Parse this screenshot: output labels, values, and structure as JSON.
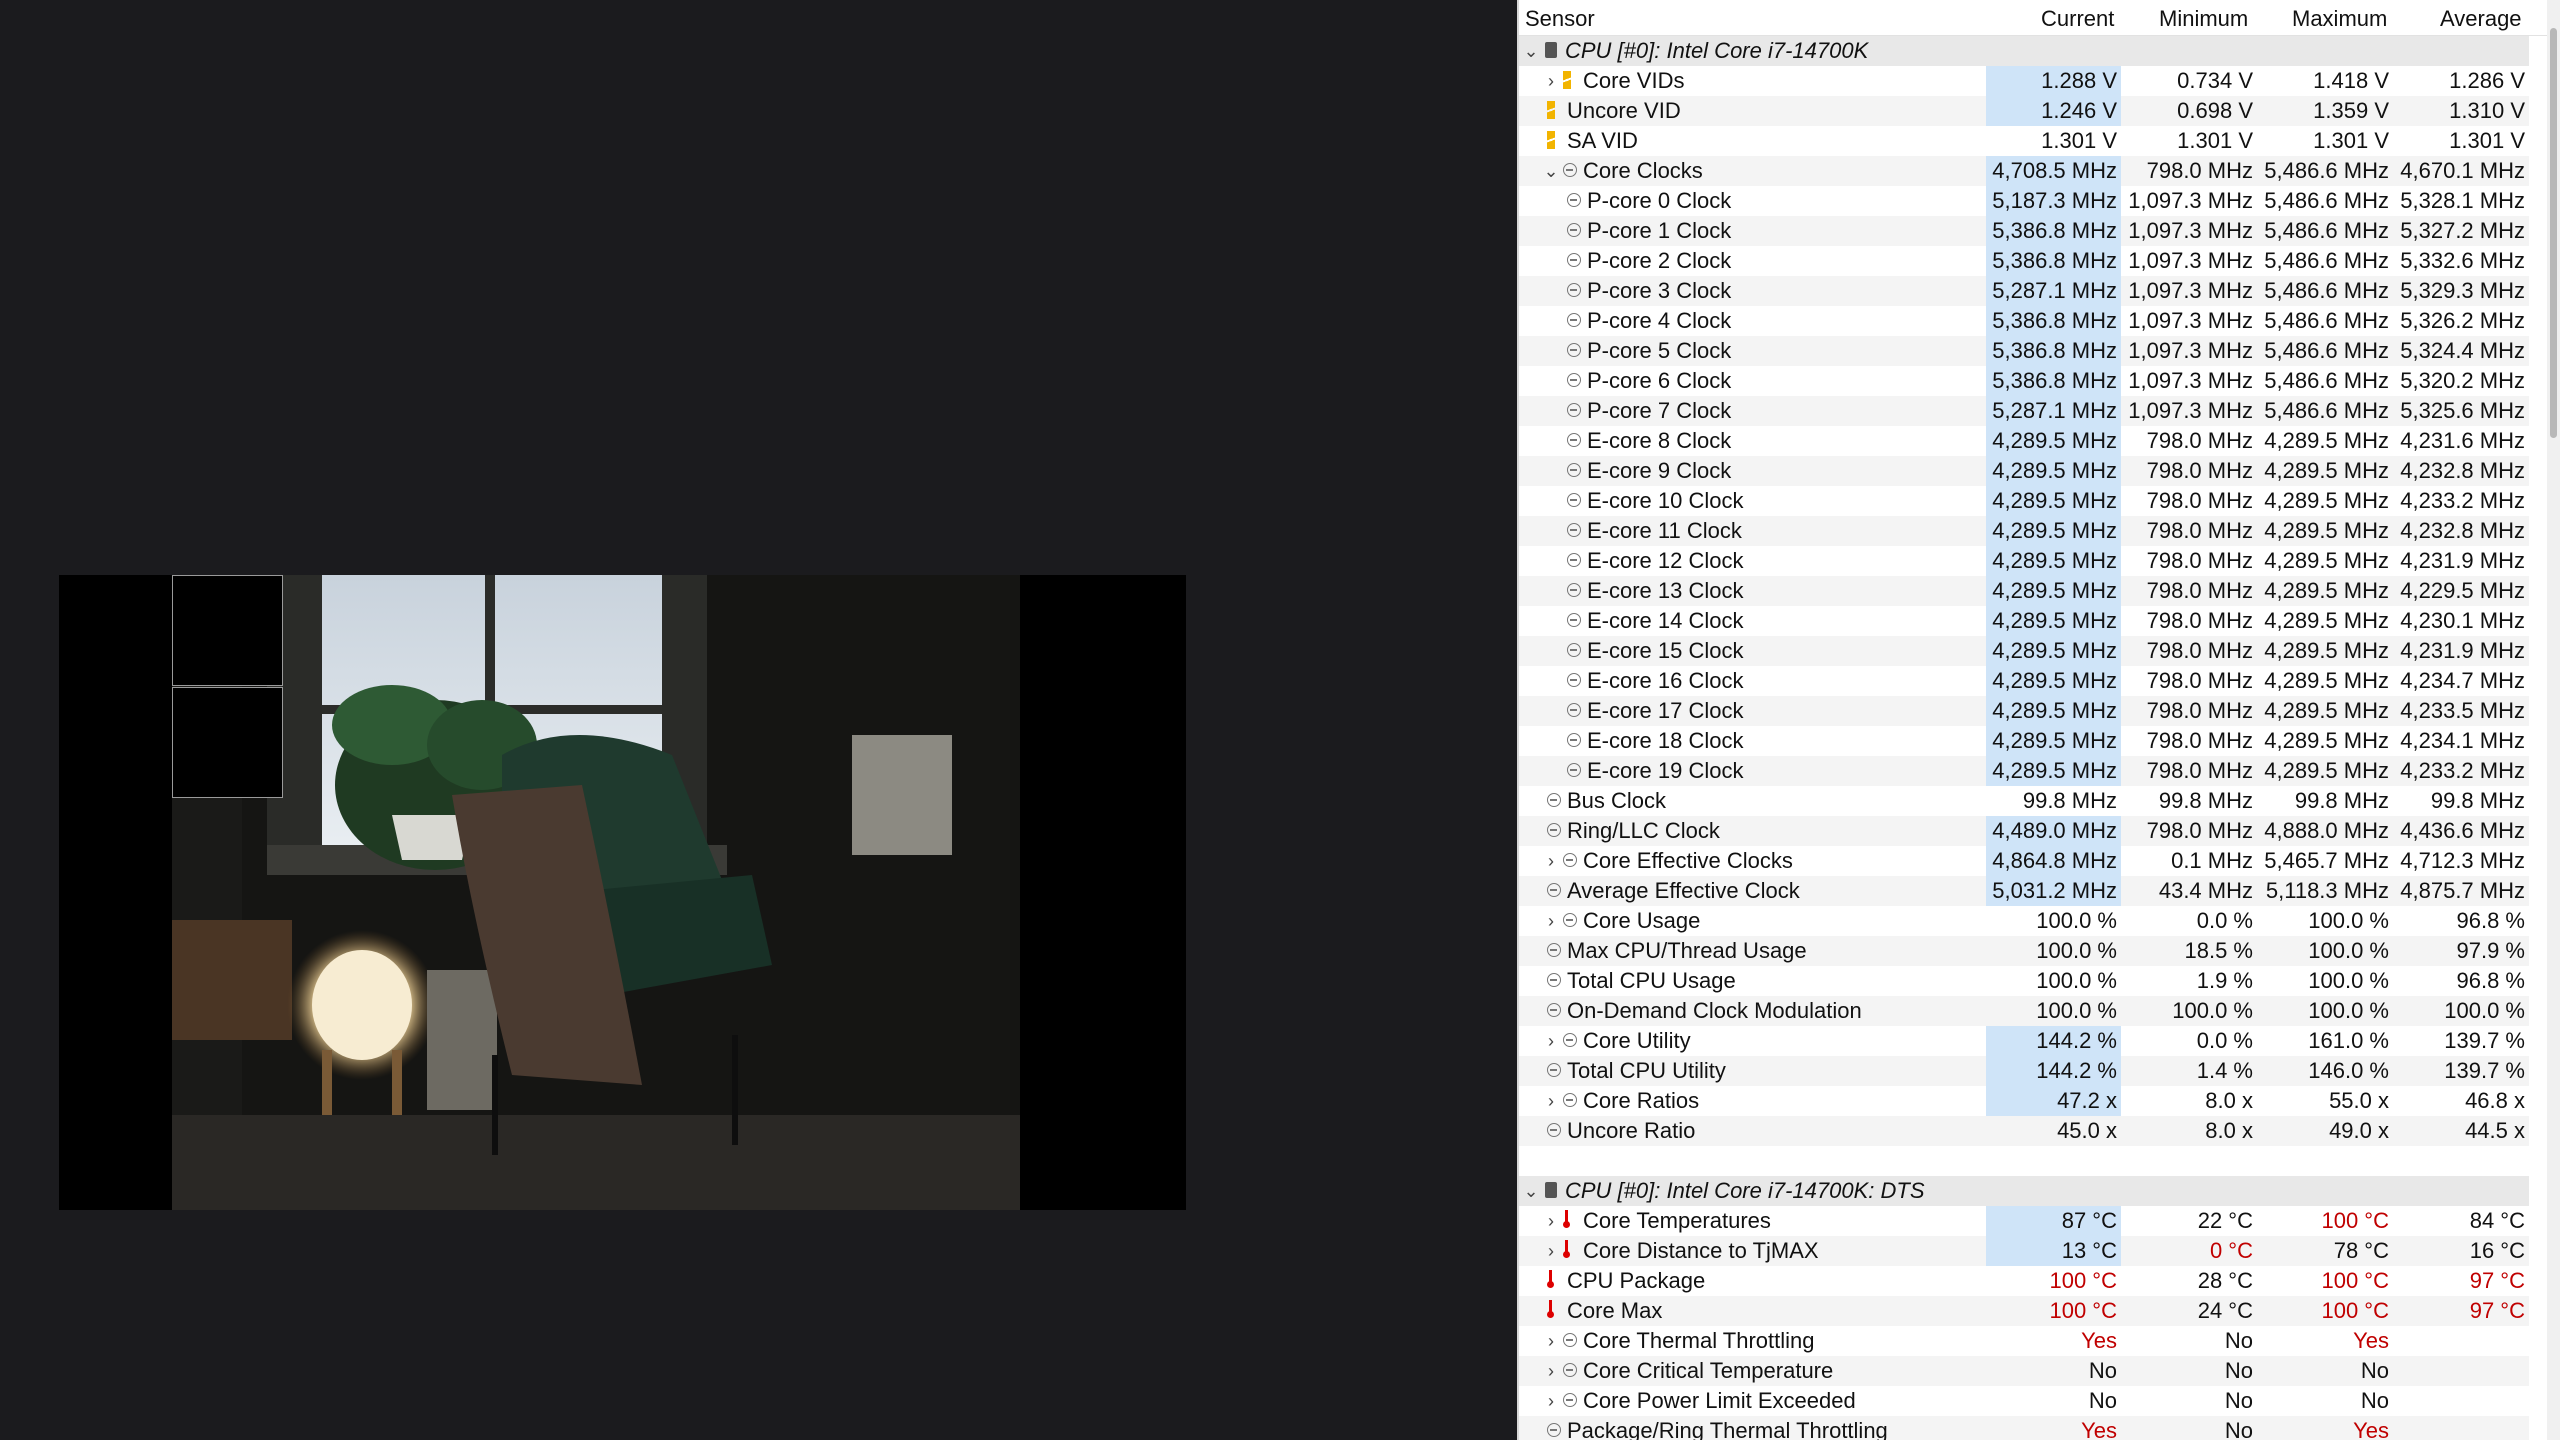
{
  "header": {
    "sensor": "Sensor",
    "current": "Current",
    "minimum": "Minimum",
    "maximum": "Maximum",
    "average": "Average"
  },
  "colors": {
    "highlight": "#cfe4f8",
    "alarm": "#c00000",
    "group_bg": "#e8e8e8"
  },
  "rows": [
    {
      "label": "CPU [#0]: Intel Core i7-14700K",
      "type": "group",
      "icon": "chip-icon",
      "expand": "⌄"
    },
    {
      "label": "Core VIDs",
      "icon": "voltage-icon",
      "expand": "›",
      "indent": 1,
      "cur": "1.288 V",
      "min": "0.734 V",
      "max": "1.418 V",
      "avg": "1.286 V",
      "hl": true
    },
    {
      "label": "Uncore VID",
      "icon": "voltage-icon",
      "indent": 1,
      "cur": "1.246 V",
      "min": "0.698 V",
      "max": "1.359 V",
      "avg": "1.310 V",
      "hl": true
    },
    {
      "label": "SA VID",
      "icon": "voltage-icon",
      "indent": 1,
      "cur": "1.301 V",
      "min": "1.301 V",
      "max": "1.301 V",
      "avg": "1.301 V"
    },
    {
      "label": "Core Clocks",
      "icon": "clock-icon",
      "expand": "⌄",
      "indent": 1,
      "cur": "4,708.5 MHz",
      "min": "798.0 MHz",
      "max": "5,486.6 MHz",
      "avg": "4,670.1 MHz",
      "hl": true
    },
    {
      "label": "P-core 0 Clock",
      "icon": "clock-icon",
      "indent": 2,
      "cur": "5,187.3 MHz",
      "min": "1,097.3 MHz",
      "max": "5,486.6 MHz",
      "avg": "5,328.1 MHz",
      "hl": true
    },
    {
      "label": "P-core 1 Clock",
      "icon": "clock-icon",
      "indent": 2,
      "cur": "5,386.8 MHz",
      "min": "1,097.3 MHz",
      "max": "5,486.6 MHz",
      "avg": "5,327.2 MHz",
      "hl": true
    },
    {
      "label": "P-core 2 Clock",
      "icon": "clock-icon",
      "indent": 2,
      "cur": "5,386.8 MHz",
      "min": "1,097.3 MHz",
      "max": "5,486.6 MHz",
      "avg": "5,332.6 MHz",
      "hl": true
    },
    {
      "label": "P-core 3 Clock",
      "icon": "clock-icon",
      "indent": 2,
      "cur": "5,287.1 MHz",
      "min": "1,097.3 MHz",
      "max": "5,486.6 MHz",
      "avg": "5,329.3 MHz",
      "hl": true
    },
    {
      "label": "P-core 4 Clock",
      "icon": "clock-icon",
      "indent": 2,
      "cur": "5,386.8 MHz",
      "min": "1,097.3 MHz",
      "max": "5,486.6 MHz",
      "avg": "5,326.2 MHz",
      "hl": true
    },
    {
      "label": "P-core 5 Clock",
      "icon": "clock-icon",
      "indent": 2,
      "cur": "5,386.8 MHz",
      "min": "1,097.3 MHz",
      "max": "5,486.6 MHz",
      "avg": "5,324.4 MHz",
      "hl": true
    },
    {
      "label": "P-core 6 Clock",
      "icon": "clock-icon",
      "indent": 2,
      "cur": "5,386.8 MHz",
      "min": "1,097.3 MHz",
      "max": "5,486.6 MHz",
      "avg": "5,320.2 MHz",
      "hl": true
    },
    {
      "label": "P-core 7 Clock",
      "icon": "clock-icon",
      "indent": 2,
      "cur": "5,287.1 MHz",
      "min": "1,097.3 MHz",
      "max": "5,486.6 MHz",
      "avg": "5,325.6 MHz",
      "hl": true
    },
    {
      "label": "E-core 8 Clock",
      "icon": "clock-icon",
      "indent": 2,
      "cur": "4,289.5 MHz",
      "min": "798.0 MHz",
      "max": "4,289.5 MHz",
      "avg": "4,231.6 MHz",
      "hl": true
    },
    {
      "label": "E-core 9 Clock",
      "icon": "clock-icon",
      "indent": 2,
      "cur": "4,289.5 MHz",
      "min": "798.0 MHz",
      "max": "4,289.5 MHz",
      "avg": "4,232.8 MHz",
      "hl": true
    },
    {
      "label": "E-core 10 Clock",
      "icon": "clock-icon",
      "indent": 2,
      "cur": "4,289.5 MHz",
      "min": "798.0 MHz",
      "max": "4,289.5 MHz",
      "avg": "4,233.2 MHz",
      "hl": true
    },
    {
      "label": "E-core 11 Clock",
      "icon": "clock-icon",
      "indent": 2,
      "cur": "4,289.5 MHz",
      "min": "798.0 MHz",
      "max": "4,289.5 MHz",
      "avg": "4,232.8 MHz",
      "hl": true
    },
    {
      "label": "E-core 12 Clock",
      "icon": "clock-icon",
      "indent": 2,
      "cur": "4,289.5 MHz",
      "min": "798.0 MHz",
      "max": "4,289.5 MHz",
      "avg": "4,231.9 MHz",
      "hl": true
    },
    {
      "label": "E-core 13 Clock",
      "icon": "clock-icon",
      "indent": 2,
      "cur": "4,289.5 MHz",
      "min": "798.0 MHz",
      "max": "4,289.5 MHz",
      "avg": "4,229.5 MHz",
      "hl": true
    },
    {
      "label": "E-core 14 Clock",
      "icon": "clock-icon",
      "indent": 2,
      "cur": "4,289.5 MHz",
      "min": "798.0 MHz",
      "max": "4,289.5 MHz",
      "avg": "4,230.1 MHz",
      "hl": true
    },
    {
      "label": "E-core 15 Clock",
      "icon": "clock-icon",
      "indent": 2,
      "cur": "4,289.5 MHz",
      "min": "798.0 MHz",
      "max": "4,289.5 MHz",
      "avg": "4,231.9 MHz",
      "hl": true
    },
    {
      "label": "E-core 16 Clock",
      "icon": "clock-icon",
      "indent": 2,
      "cur": "4,289.5 MHz",
      "min": "798.0 MHz",
      "max": "4,289.5 MHz",
      "avg": "4,234.7 MHz",
      "hl": true
    },
    {
      "label": "E-core 17 Clock",
      "icon": "clock-icon",
      "indent": 2,
      "cur": "4,289.5 MHz",
      "min": "798.0 MHz",
      "max": "4,289.5 MHz",
      "avg": "4,233.5 MHz",
      "hl": true
    },
    {
      "label": "E-core 18 Clock",
      "icon": "clock-icon",
      "indent": 2,
      "cur": "4,289.5 MHz",
      "min": "798.0 MHz",
      "max": "4,289.5 MHz",
      "avg": "4,234.1 MHz",
      "hl": true
    },
    {
      "label": "E-core 19 Clock",
      "icon": "clock-icon",
      "indent": 2,
      "cur": "4,289.5 MHz",
      "min": "798.0 MHz",
      "max": "4,289.5 MHz",
      "avg": "4,233.2 MHz",
      "hl": true
    },
    {
      "label": "Bus Clock",
      "icon": "clock-icon",
      "indent": 1,
      "cur": "99.8 MHz",
      "min": "99.8 MHz",
      "max": "99.8 MHz",
      "avg": "99.8 MHz"
    },
    {
      "label": "Ring/LLC Clock",
      "icon": "clock-icon",
      "indent": 1,
      "cur": "4,489.0 MHz",
      "min": "798.0 MHz",
      "max": "4,888.0 MHz",
      "avg": "4,436.6 MHz",
      "hl": true
    },
    {
      "label": "Core Effective Clocks",
      "icon": "clock-icon",
      "expand": "›",
      "indent": 1,
      "cur": "4,864.8 MHz",
      "min": "0.1 MHz",
      "max": "5,465.7 MHz",
      "avg": "4,712.3 MHz",
      "hl": true
    },
    {
      "label": "Average Effective Clock",
      "icon": "clock-icon",
      "indent": 1,
      "cur": "5,031.2 MHz",
      "min": "43.4 MHz",
      "max": "5,118.3 MHz",
      "avg": "4,875.7 MHz",
      "hl": true
    },
    {
      "label": "Core Usage",
      "icon": "clock-icon",
      "expand": "›",
      "indent": 1,
      "cur": "100.0 %",
      "min": "0.0 %",
      "max": "100.0 %",
      "avg": "96.8 %"
    },
    {
      "label": "Max CPU/Thread Usage",
      "icon": "clock-icon",
      "indent": 1,
      "cur": "100.0 %",
      "min": "18.5 %",
      "max": "100.0 %",
      "avg": "97.9 %"
    },
    {
      "label": "Total CPU Usage",
      "icon": "clock-icon",
      "indent": 1,
      "cur": "100.0 %",
      "min": "1.9 %",
      "max": "100.0 %",
      "avg": "96.8 %"
    },
    {
      "label": "On-Demand Clock Modulation",
      "icon": "clock-icon",
      "indent": 1,
      "cur": "100.0 %",
      "min": "100.0 %",
      "max": "100.0 %",
      "avg": "100.0 %"
    },
    {
      "label": "Core Utility",
      "icon": "clock-icon",
      "expand": "›",
      "indent": 1,
      "cur": "144.2 %",
      "min": "0.0 %",
      "max": "161.0 %",
      "avg": "139.7 %",
      "hl": true
    },
    {
      "label": "Total CPU Utility",
      "icon": "clock-icon",
      "indent": 1,
      "cur": "144.2 %",
      "min": "1.4 %",
      "max": "146.0 %",
      "avg": "139.7 %",
      "hl": true
    },
    {
      "label": "Core Ratios",
      "icon": "clock-icon",
      "expand": "›",
      "indent": 1,
      "cur": "47.2 x",
      "min": "8.0 x",
      "max": "55.0 x",
      "avg": "46.8 x",
      "hl": true
    },
    {
      "label": "Uncore Ratio",
      "icon": "clock-icon",
      "indent": 1,
      "cur": "45.0 x",
      "min": "8.0 x",
      "max": "49.0 x",
      "avg": "44.5 x"
    },
    {
      "label": "",
      "type": "spacer"
    },
    {
      "label": "CPU [#0]: Intel Core i7-14700K: DTS",
      "type": "group",
      "icon": "chip-icon",
      "expand": "⌄"
    },
    {
      "label": "Core Temperatures",
      "icon": "thermometer-icon",
      "expand": "›",
      "indent": 1,
      "cur": "87 °C",
      "min": "22 °C",
      "max": "100 °C",
      "avg": "84 °C",
      "hl": true,
      "maxRed": true
    },
    {
      "label": "Core Distance to TjMAX",
      "icon": "thermometer-icon",
      "expand": "›",
      "indent": 1,
      "cur": "13 °C",
      "min": "0 °C",
      "max": "78 °C",
      "avg": "16 °C",
      "hl": true,
      "minRed": true
    },
    {
      "label": "CPU Package",
      "icon": "thermometer-icon",
      "indent": 1,
      "cur": "100 °C",
      "min": "28 °C",
      "max": "100 °C",
      "avg": "97 °C",
      "curRed": true,
      "maxRed": true,
      "avgRed": true
    },
    {
      "label": "Core Max",
      "icon": "thermometer-icon",
      "indent": 1,
      "cur": "100 °C",
      "min": "24 °C",
      "max": "100 °C",
      "avg": "97 °C",
      "curRed": true,
      "maxRed": true,
      "avgRed": true
    },
    {
      "label": "Core Thermal Throttling",
      "icon": "clock-icon",
      "expand": "›",
      "indent": 1,
      "cur": "Yes",
      "min": "No",
      "max": "Yes",
      "avg": "",
      "curRed": true,
      "maxRed": true
    },
    {
      "label": "Core Critical Temperature",
      "icon": "clock-icon",
      "expand": "›",
      "indent": 1,
      "cur": "No",
      "min": "No",
      "max": "No",
      "avg": ""
    },
    {
      "label": "Core Power Limit Exceeded",
      "icon": "clock-icon",
      "expand": "›",
      "indent": 1,
      "cur": "No",
      "min": "No",
      "max": "No",
      "avg": ""
    },
    {
      "label": "Package/Ring Thermal Throttling",
      "icon": "clock-icon",
      "indent": 1,
      "cur": "Yes",
      "min": "No",
      "max": "Yes",
      "avg": "",
      "curRed": true,
      "maxRed": true
    }
  ]
}
